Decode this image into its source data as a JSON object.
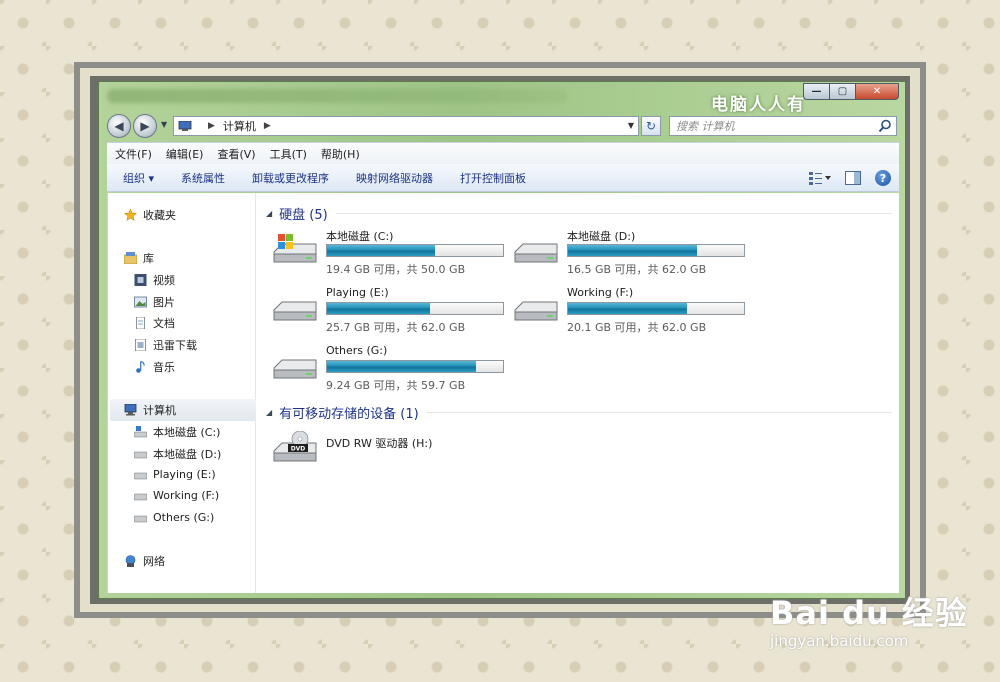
{
  "window": {
    "watermark": "电脑人人有",
    "caption_min": "—",
    "caption_max": "▢",
    "caption_close": "✕"
  },
  "address": {
    "path": "计算机",
    "search_placeholder": "搜索 计算机"
  },
  "menu": {
    "items": [
      "文件(F)",
      "编辑(E)",
      "查看(V)",
      "工具(T)",
      "帮助(H)"
    ]
  },
  "toolbar": {
    "organize": "组织 ▾",
    "items": [
      "系统属性",
      "卸载或更改程序",
      "映射网络驱动器",
      "打开控制面板"
    ]
  },
  "nav": {
    "favorites": "收藏夹",
    "libraries": "库",
    "library_items": [
      "视频",
      "图片",
      "文档",
      "迅雷下载",
      "音乐"
    ],
    "computer": "计算机",
    "computer_items": [
      "本地磁盘 (C:)",
      "本地磁盘 (D:)",
      "Playing (E:)",
      "Working (F:)",
      "Others (G:)"
    ],
    "network": "网络"
  },
  "groups": {
    "hard_disks": "硬盘 (5)",
    "removable": "有可移动存储的设备 (1)"
  },
  "drives": [
    {
      "name": "本地磁盘 (C:)",
      "info": "19.4 GB 可用，共 50.0 GB",
      "used_fraction": 0.612
    },
    {
      "name": "本地磁盘 (D:)",
      "info": "16.5 GB 可用，共 62.0 GB",
      "used_fraction": 0.734
    },
    {
      "name": "Playing (E:)",
      "info": "25.7 GB 可用，共 62.0 GB",
      "used_fraction": 0.585
    },
    {
      "name": "Working (F:)",
      "info": "20.1 GB 可用，共 62.0 GB",
      "used_fraction": 0.676
    },
    {
      "name": "Others (G:)",
      "info": "9.24 GB 可用，共 59.7 GB",
      "used_fraction": 0.845
    }
  ],
  "removable_drives": [
    {
      "name": "DVD RW 驱动器 (H:)",
      "badge": "DVD"
    }
  ],
  "watermark": {
    "logo": "Bai du 经验",
    "site": "jingyan.baidu.com"
  }
}
